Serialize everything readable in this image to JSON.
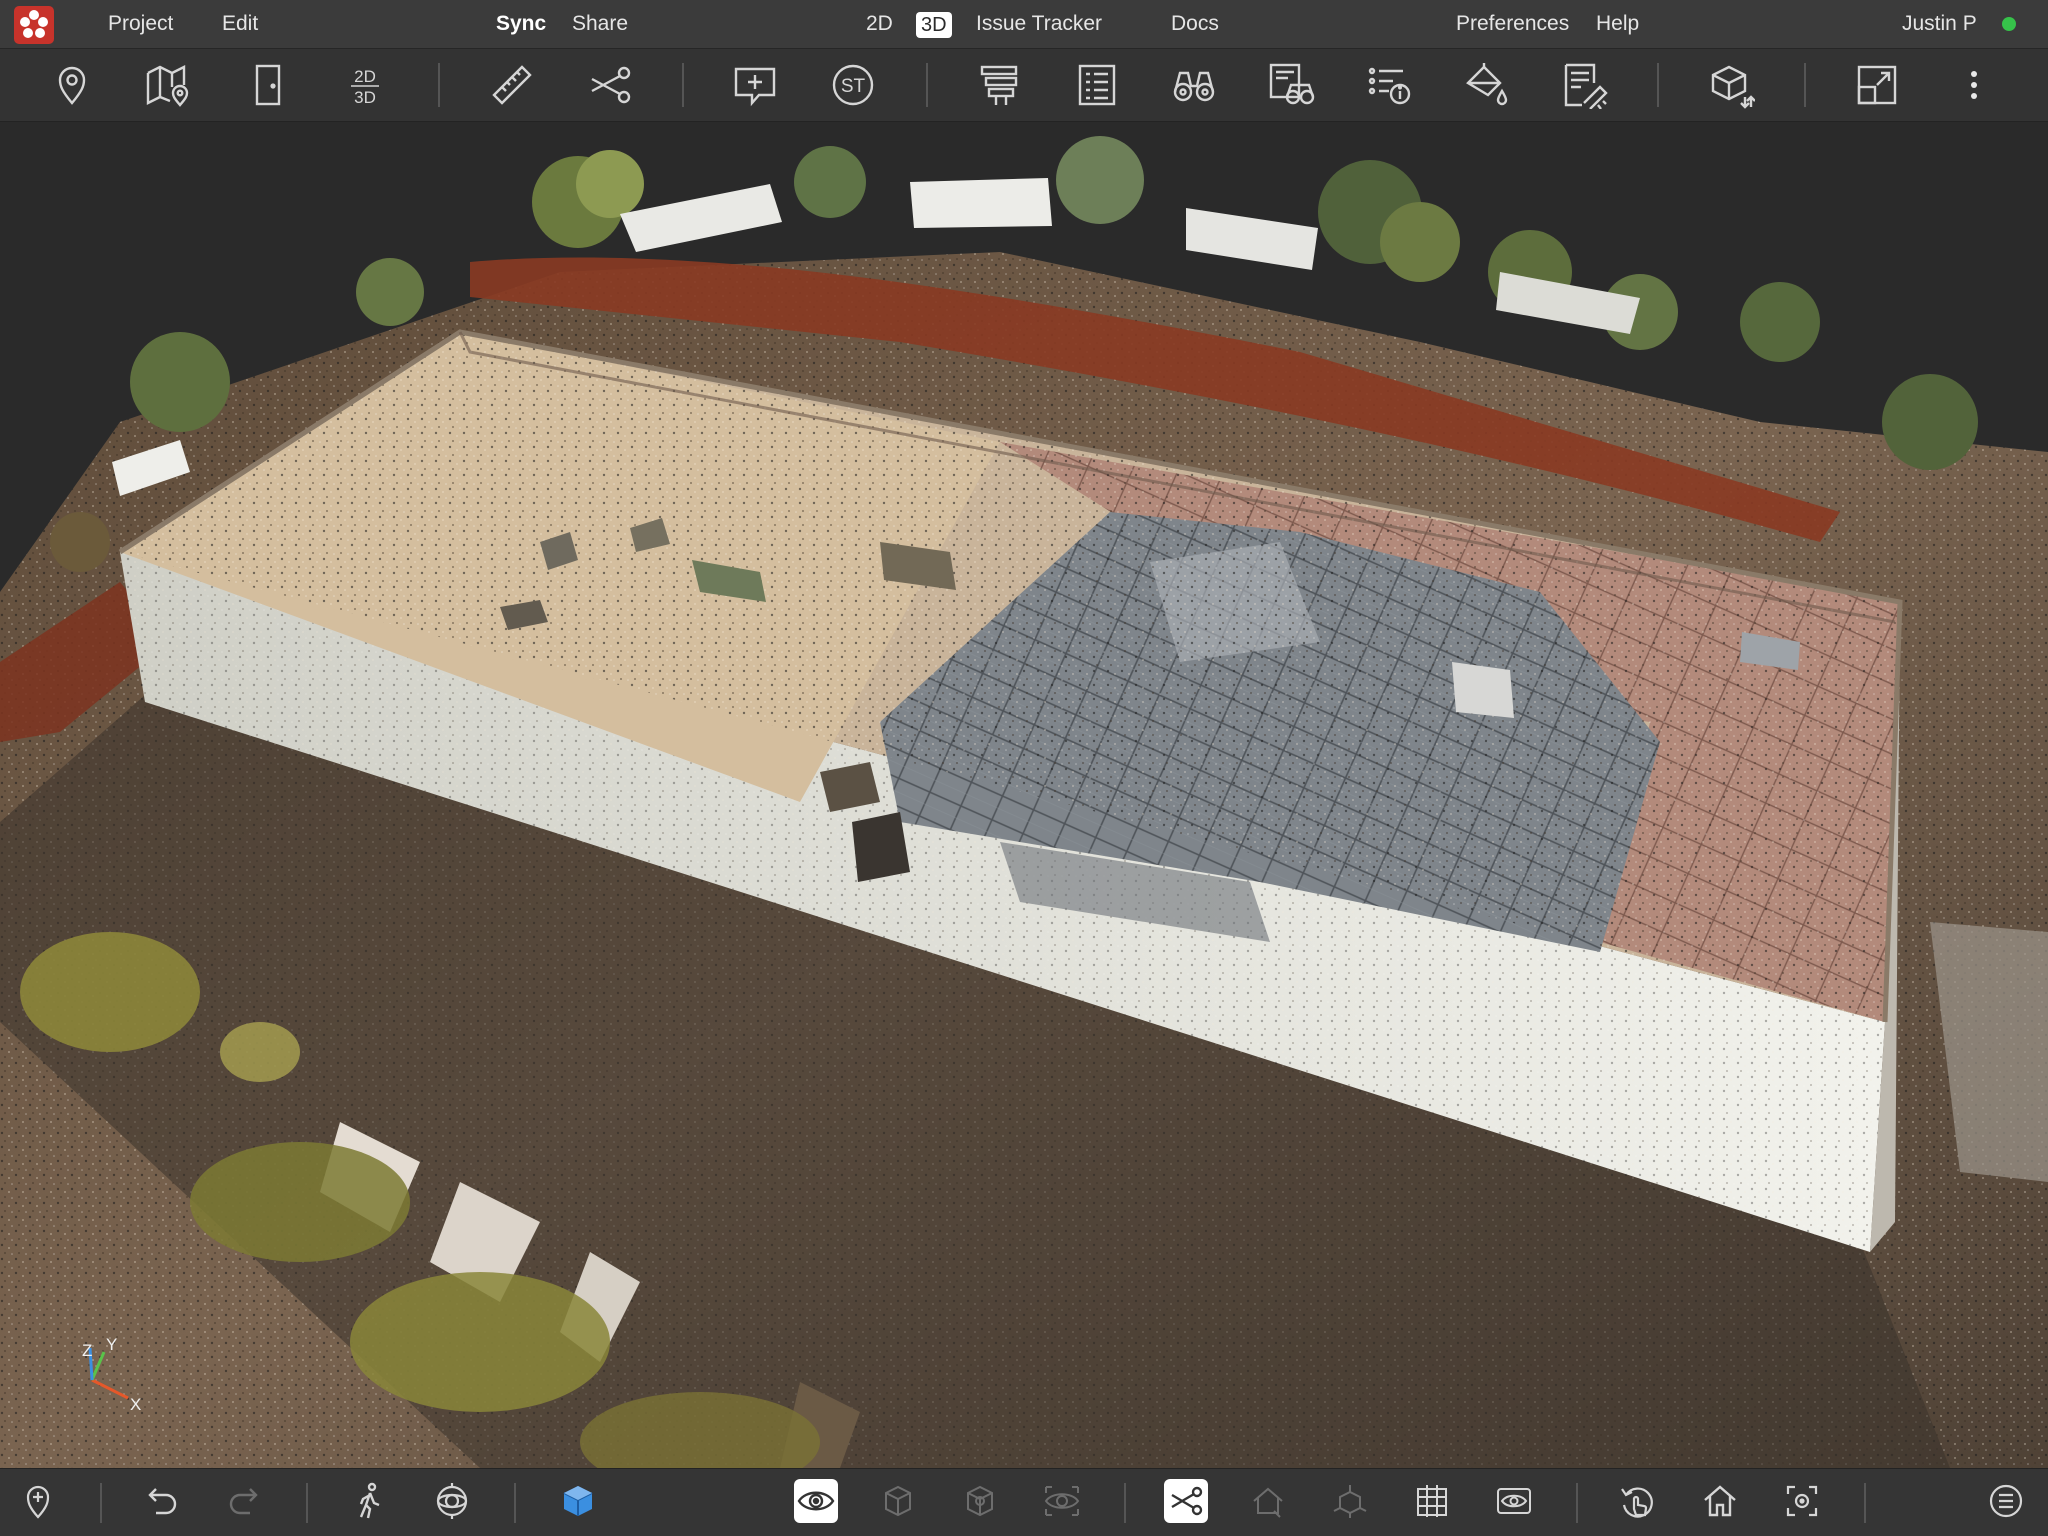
{
  "menu": {
    "project": "Project",
    "edit": "Edit",
    "sync": "Sync",
    "share": "Share",
    "view_2d": "2D",
    "view_3d": "3D",
    "issue_tracker": "Issue Tracker",
    "docs": "Docs",
    "preferences": "Preferences",
    "help": "Help",
    "user": "Justin P"
  },
  "toolbar": {
    "icons": [
      "location-pin-icon",
      "map-pin-icon",
      "door-icon",
      "2d-3d-toggle-icon",
      "ruler-icon",
      "scissors-icon",
      "add-comment-icon",
      "st-icon",
      "layers-icon",
      "list-icon",
      "binoculars-icon",
      "scan-binoculars-icon",
      "info-list-icon",
      "paint-bucket-icon",
      "notes-icon",
      "cube-export-icon",
      "resize-icon",
      "more-icon"
    ],
    "dd_top": "2D",
    "dd_bottom": "3D",
    "st_label": "ST"
  },
  "axis": {
    "x": "X",
    "y": "Y",
    "z": "Z"
  },
  "colors": {
    "menubar": "#3b3b3b",
    "toolbar": "#333333",
    "viewport_bg": "#2a2a2a",
    "accent_blue": "#3b8fe0",
    "status_green": "#36c24a",
    "logo_red": "#c7332b"
  },
  "bottombar": {
    "icons": [
      "add-location-icon",
      "undo-icon",
      "redo-icon",
      "walk-icon",
      "orbit-icon",
      "cube-icon",
      "eye-icon",
      "box-outline-icon",
      "box-shaded-icon",
      "visibility-target-icon",
      "clip-scissors-icon",
      "house-outline-icon",
      "cube-axis-icon",
      "grid-icon",
      "eye-layer-icon",
      "rotate-hand-icon",
      "home-icon",
      "focus-icon",
      "menu-circle-icon"
    ]
  }
}
